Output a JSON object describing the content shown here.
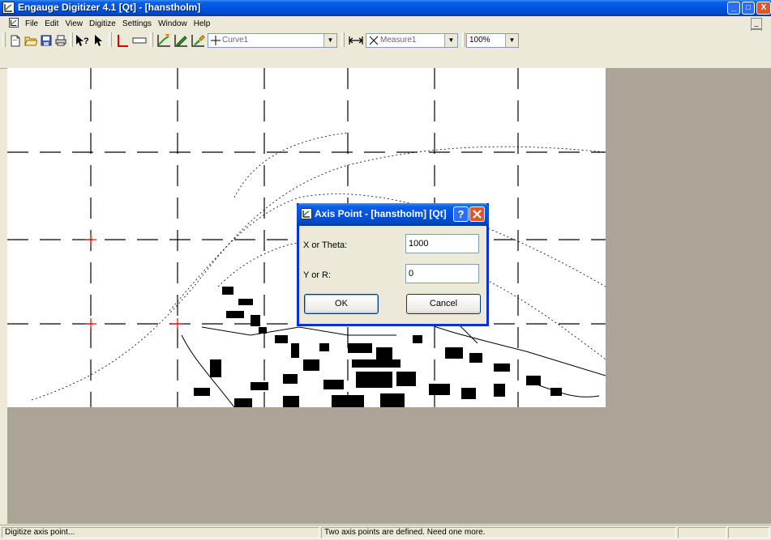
{
  "window": {
    "title": "Engauge Digitizer 4.1 [Qt] - [hanstholm]",
    "controls": {
      "minimize": "_",
      "maximize": "□",
      "close": "X"
    }
  },
  "menubar": {
    "items": [
      "File",
      "Edit",
      "View",
      "Digitize",
      "Settings",
      "Window",
      "Help"
    ],
    "mdi": {
      "minimize": "_",
      "restore": "▫"
    }
  },
  "toolbar": {
    "curve_combo": "Curve1",
    "measure_combo": "Measure1",
    "zoom_combo": "100%",
    "icons": [
      "new-document-icon",
      "open-folder-icon",
      "save-icon",
      "print-icon",
      "whats-this-icon",
      "select-arrow-icon",
      "axis-point-icon",
      "scale-bar-icon",
      "point-match-icon",
      "curve-pencil-icon",
      "segment-fill-icon",
      "measure-icon"
    ]
  },
  "dialog": {
    "title": "Axis Point - [hanstholm] [Qt]",
    "x_label": "X or Theta:",
    "x_value": "1000",
    "y_label": "Y or R:",
    "y_value": "0",
    "ok_label": "OK",
    "cancel_label": "Cancel"
  },
  "statusbar": {
    "left": "Digitize axis point...",
    "middle": "Two axis points are defined. Need one more.",
    "pane3": "",
    "pane4": ""
  },
  "colors": {
    "title_blue": "#0054e3",
    "close_red": "#d9582c",
    "axis_marker": "#ff0000",
    "workspace": "#aba598"
  }
}
